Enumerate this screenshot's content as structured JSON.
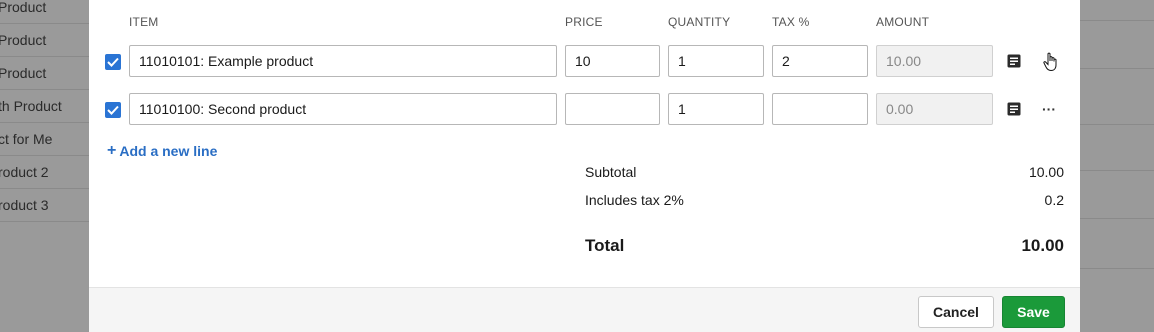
{
  "background_list": {
    "items": [
      "Product",
      "Product",
      "Product",
      "th Product",
      "ct for Me",
      "roduct 2",
      "roduct 3"
    ]
  },
  "table": {
    "headers": {
      "item": "ITEM",
      "price": "PRICE",
      "quantity": "QUANTITY",
      "tax": "TAX %",
      "amount": "AMOUNT"
    },
    "rows": [
      {
        "checked": true,
        "item": "11010101: Example product",
        "price": "10",
        "quantity": "1",
        "tax": "2",
        "amount": "10.00",
        "action_icon": "hand-cursor-icon"
      },
      {
        "checked": true,
        "item": "11010100: Second product",
        "price": "",
        "quantity": "1",
        "tax": "",
        "amount": "0.00",
        "action_icon": "more-icon"
      }
    ]
  },
  "add_line_label": "Add a new line",
  "summary": {
    "subtotal_label": "Subtotal",
    "subtotal_value": "10.00",
    "tax_label": "Includes tax 2%",
    "tax_value": "0.2",
    "total_label": "Total",
    "total_value": "10.00"
  },
  "footer": {
    "cancel_label": "Cancel",
    "save_label": "Save"
  },
  "colors": {
    "accent": "#2a74d4",
    "link": "#2a6ec4",
    "save": "#1b9a3a"
  }
}
